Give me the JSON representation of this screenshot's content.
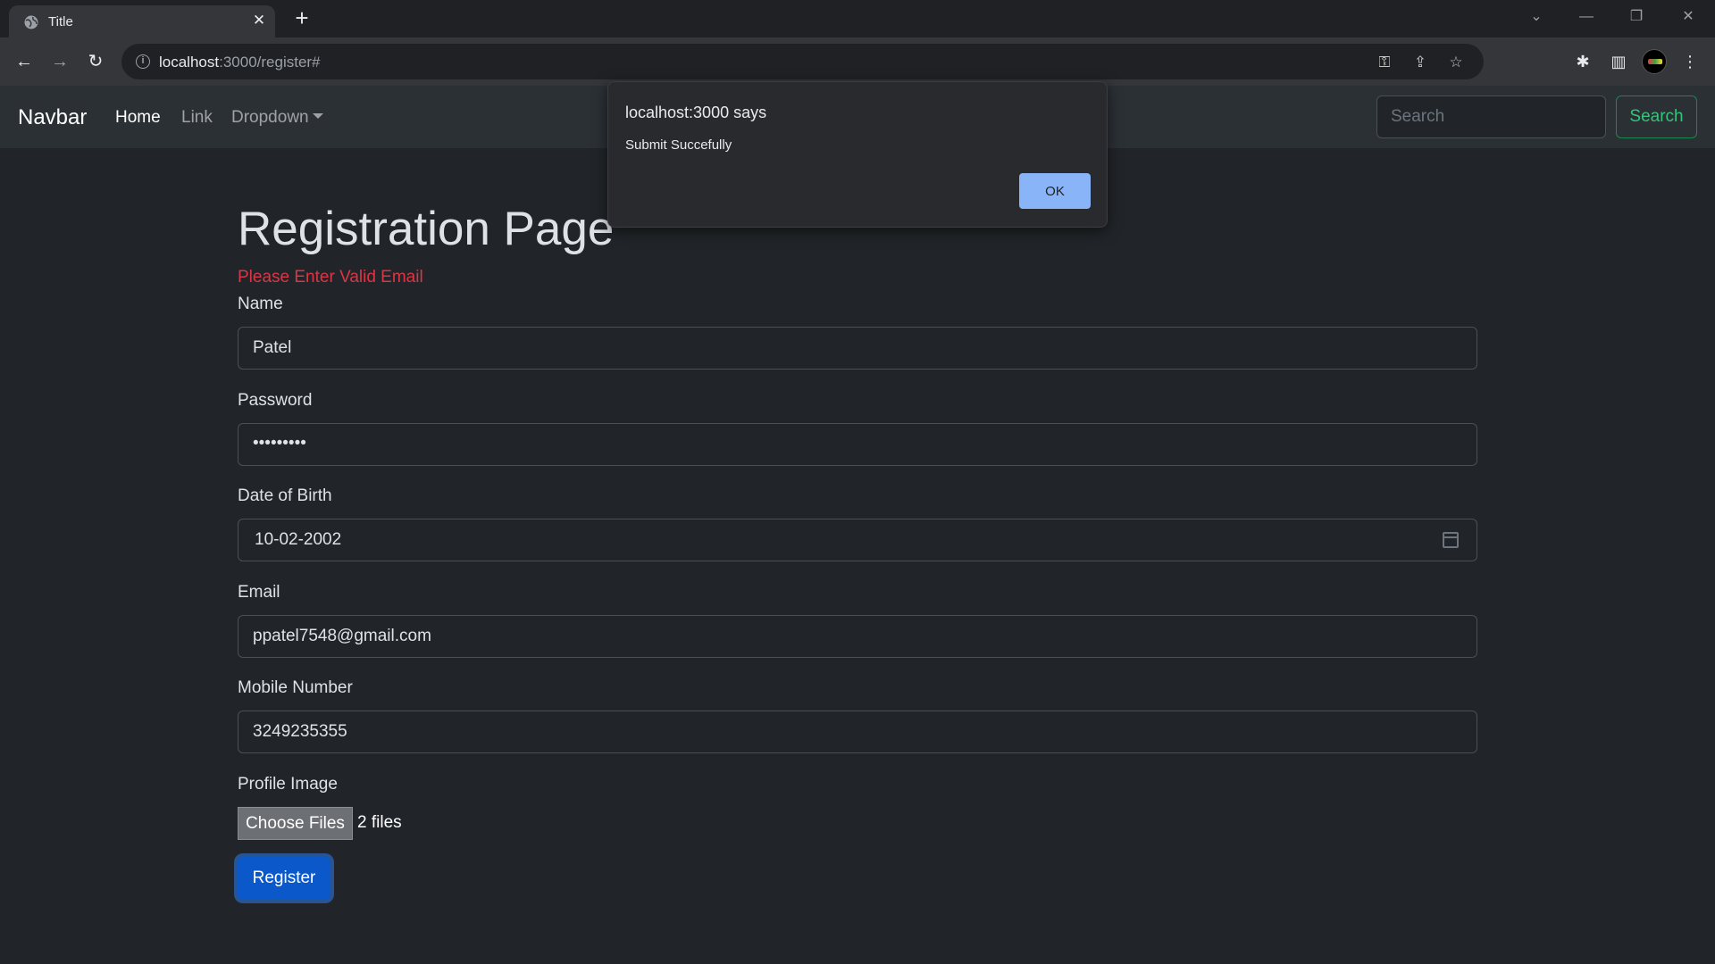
{
  "browser": {
    "tab_title": "Title",
    "url_host": "localhost",
    "url_path": ":3000/register#"
  },
  "navbar": {
    "brand": "Navbar",
    "links": [
      {
        "label": "Home",
        "active": true
      },
      {
        "label": "Link",
        "active": false
      },
      {
        "label": "Dropdown",
        "active": false
      }
    ],
    "search_placeholder": "Search",
    "search_button": "Search"
  },
  "form": {
    "heading": "Registration Page",
    "error": "Please Enter Valid Email",
    "name_label": "Name",
    "name_value": "Patel",
    "password_label": "Password",
    "password_value": "•••••••••",
    "dob_label": "Date of Birth",
    "dob_value": "10-02-2002",
    "email_label": "Email",
    "email_value": "ppatel7548@gmail.com",
    "mobile_label": "Mobile Number",
    "mobile_value": "3249235355",
    "image_label": "Profile Image",
    "choose_button": "Choose Files",
    "files_text": "2 files",
    "register_button": "Register"
  },
  "dialog": {
    "title": "localhost:3000 says",
    "message": "Submit Succefully",
    "ok_button": "OK"
  },
  "colors": {
    "page_bg": "#212529",
    "navbar_bg": "#2b3035",
    "error": "#dc3545",
    "primary": "#0a58ca",
    "success": "#198754",
    "dialog_ok": "#8ab4f8"
  }
}
